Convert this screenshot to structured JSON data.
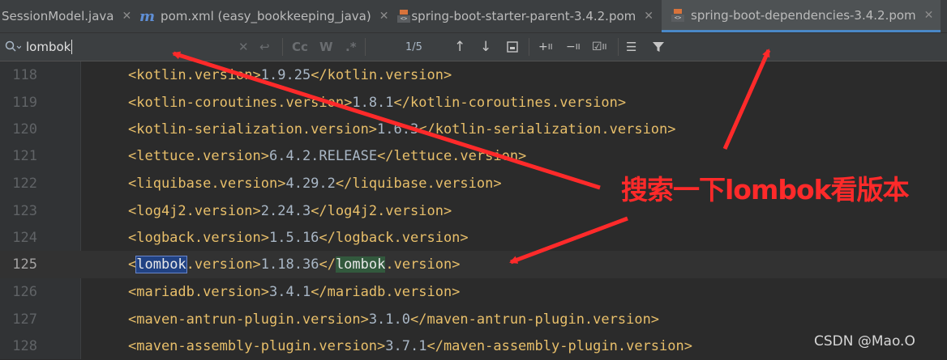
{
  "tabs": [
    {
      "label": "SessionModel.java",
      "icon": "none"
    },
    {
      "label": "pom.xml (easy_bookkeeping_java)",
      "icon": "m-icon"
    },
    {
      "label": "spring-boot-starter-parent-3.4.2.pom",
      "icon": "xml-file-icon"
    },
    {
      "label": "spring-boot-dependencies-3.4.2.pom",
      "icon": "xml-file-icon",
      "active": true
    }
  ],
  "find": {
    "query": "lombok",
    "match_case_label": "Cc",
    "words_label": "W",
    "regex_label": ".*",
    "match_count": "1/5"
  },
  "editor": {
    "current_line": "125",
    "lines": [
      {
        "num": "118",
        "open": "<kotlin.version>",
        "value": "1.9.25",
        "close": "</kotlin.version>"
      },
      {
        "num": "119",
        "open": "<kotlin-coroutines.version>",
        "value": "1.8.1",
        "close": "</kotlin-coroutines.version>"
      },
      {
        "num": "120",
        "open": "<kotlin-serialization.version>",
        "value": "1.6.3",
        "close": "</kotlin-serialization.version>"
      },
      {
        "num": "121",
        "open": "<lettuce.version>",
        "value": "6.4.2.RELEASE",
        "close": "</lettuce.version>"
      },
      {
        "num": "122",
        "open": "<liquibase.version>",
        "value": "4.29.2",
        "close": "</liquibase.version>"
      },
      {
        "num": "123",
        "open": "<log4j2.version>",
        "value": "2.24.3",
        "close": "</log4j2.version>"
      },
      {
        "num": "124",
        "open": "<logback.version>",
        "value": "1.5.16",
        "close": "</logback.version>"
      },
      {
        "num": "125",
        "open": "<",
        "match1": "lombok",
        "open_rest": ".version>",
        "value": "1.18.36",
        "close_start": "</",
        "match2": "lombok",
        "close_rest": ".version>"
      },
      {
        "num": "126",
        "open": "<mariadb.version>",
        "value": "3.4.1",
        "close": "</mariadb.version>"
      },
      {
        "num": "127",
        "open": "<maven-antrun-plugin.version>",
        "value": "3.1.0",
        "close": "</maven-antrun-plugin.version>"
      },
      {
        "num": "128",
        "open": "<maven-assembly-plugin.version>",
        "value": "3.7.1",
        "close": "</maven-assembly-plugin.version>"
      }
    ]
  },
  "annotation": {
    "text": "搜索一下lombok看版本",
    "color": "#ff2a2a"
  },
  "watermark": "CSDN @Mao.O",
  "colors": {
    "tag": "#e8bf6a",
    "text": "#a9b7c6",
    "accent": "#4a88c7",
    "annotation": "#ff2a2a"
  }
}
